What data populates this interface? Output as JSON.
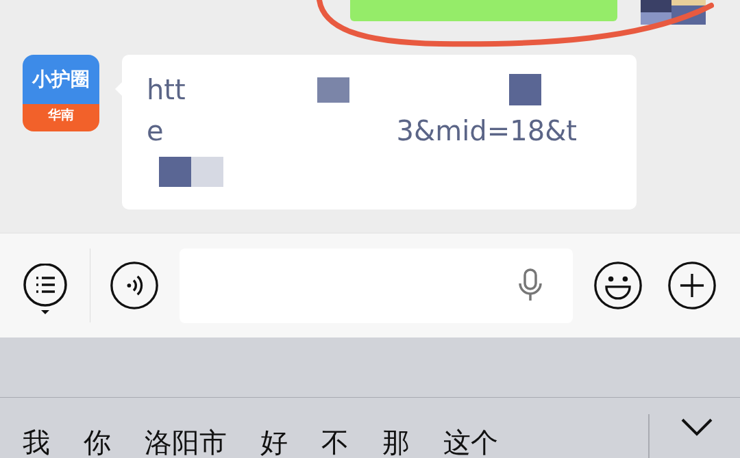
{
  "messages": [
    {
      "kind": "sent"
    },
    {
      "kind": "received",
      "avatar": {
        "title": "小护圈",
        "region": "华南"
      },
      "lines": [
        [
          {
            "kind": "text",
            "text": "htt"
          },
          {
            "kind": "redaction"
          },
          {
            "kind": "redaction"
          }
        ],
        [
          {
            "kind": "text",
            "text": "e"
          },
          {
            "kind": "text",
            "text": "3&mid=18&t"
          }
        ],
        [
          {
            "kind": "redaction"
          },
          {
            "kind": "redaction"
          }
        ]
      ]
    }
  ],
  "candidates": [
    "我",
    "你",
    "洛阳市",
    "好",
    "不",
    "那",
    "这个"
  ]
}
